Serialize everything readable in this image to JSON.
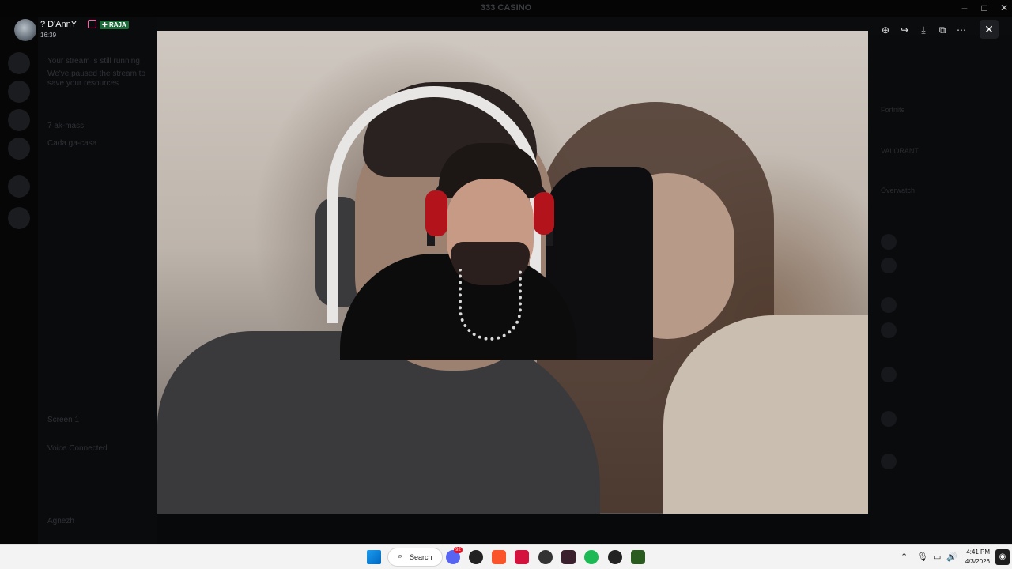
{
  "window": {
    "title": "333 CASINO"
  },
  "viewer": {
    "user": {
      "name": "? D'AnnY",
      "tag": "RAJA",
      "time": "16:39"
    },
    "toolbar": {
      "zoom": "search-plus",
      "forward": "forward",
      "download": "download",
      "open": "open-external",
      "more": "more"
    }
  },
  "backdrop": {
    "channels": [
      "Your stream is still running",
      "We've paused the stream to",
      "save your resources",
      "7 ak-mass",
      "Cada ga-casa",
      "Screen 1",
      "Voice Connected",
      "Agnezh"
    ],
    "members": [
      "Fortnite",
      "VALORANT",
      "Overwatch"
    ]
  },
  "taskbar": {
    "search_label": "Search",
    "notification_badge": "92",
    "time": "4:41 PM",
    "date": "4/3/2026"
  }
}
